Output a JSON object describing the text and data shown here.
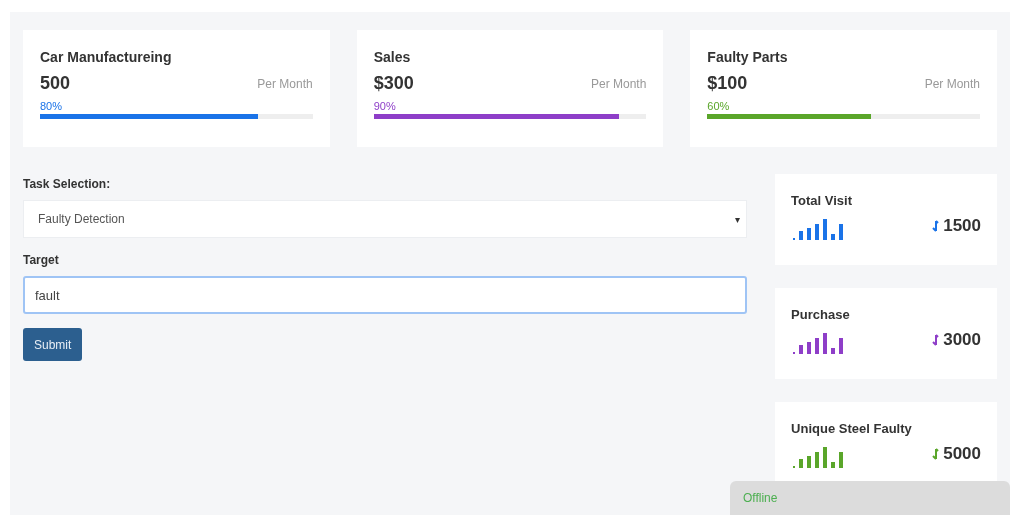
{
  "stat_cards": [
    {
      "title": "Car Manufactureing",
      "value": "500",
      "unit": "Per Month",
      "percent": "80%",
      "level": 0.8,
      "color": "#1a73e8"
    },
    {
      "title": "Sales",
      "value": "$300",
      "unit": "Per Month",
      "percent": "90%",
      "level": 0.9,
      "color": "#8e3ec8"
    },
    {
      "title": "Faulty Parts",
      "value": "$100",
      "unit": "Per Month",
      "percent": "60%",
      "level": 0.6,
      "color": "#5aa62a"
    }
  ],
  "form": {
    "select_label": "Task Selection:",
    "select_value": "Faulty Detection",
    "caret": "▾",
    "target_label": "Target",
    "target_value": "fault",
    "submit": "Submit"
  },
  "mini_cards": [
    {
      "title": "Total Visit",
      "value": "1500",
      "color": "#1a73e8"
    },
    {
      "title": "Purchase",
      "value": "3000",
      "color": "#8e3ec8"
    },
    {
      "title": "Unique Steel Faulty",
      "value": "5000",
      "color": "#5aa62a"
    }
  ],
  "status": {
    "label": "Offline"
  }
}
